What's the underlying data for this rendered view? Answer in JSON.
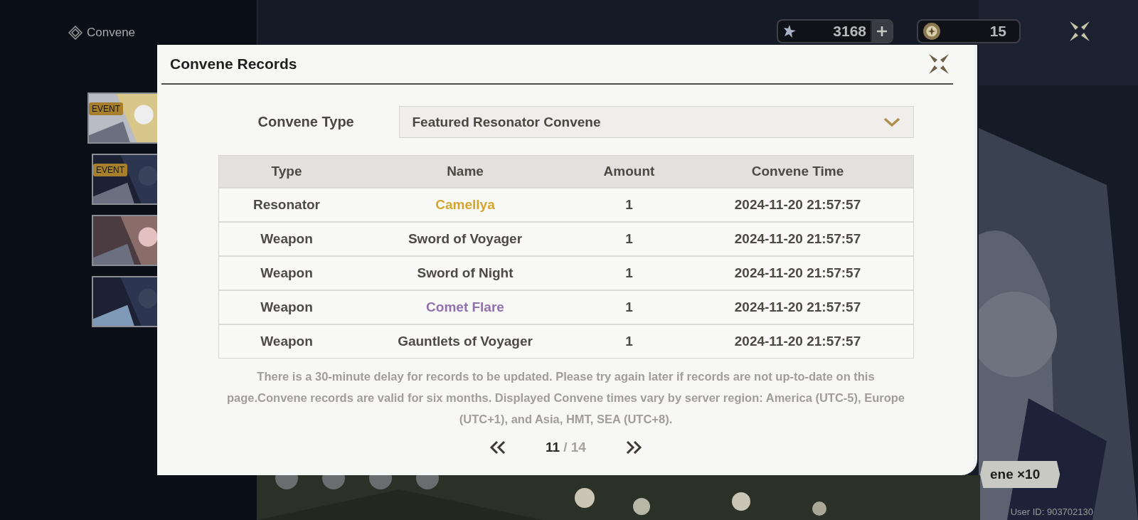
{
  "nav": {
    "title": "Convene"
  },
  "banner_badges": [
    "EVENT",
    "EVENT"
  ],
  "currencies": [
    {
      "kind": "astrite",
      "amount": "3168",
      "add": true
    },
    {
      "kind": "tide",
      "amount": "15",
      "add": false
    }
  ],
  "dialog": {
    "title": "Convene Records",
    "filter": {
      "label": "Convene Type",
      "value": "Featured Resonator Convene"
    },
    "table": {
      "columns": [
        "Type",
        "Name",
        "Amount",
        "Convene Time"
      ],
      "rows": [
        {
          "type": "Resonator",
          "name": "Camellya",
          "amount": "1",
          "time": "2024-11-20 21:57:57",
          "color": "#d4a52e"
        },
        {
          "type": "Weapon",
          "name": "Sword of Voyager",
          "amount": "1",
          "time": "2024-11-20 21:57:57",
          "color": "#4d4943"
        },
        {
          "type": "Weapon",
          "name": "Sword of Night",
          "amount": "1",
          "time": "2024-11-20 21:57:57",
          "color": "#4d4943"
        },
        {
          "type": "Weapon",
          "name": "Comet Flare",
          "amount": "1",
          "time": "2024-11-20 21:57:57",
          "color": "#9070ae"
        },
        {
          "type": "Weapon",
          "name": "Gauntlets of Voyager",
          "amount": "1",
          "time": "2024-11-20 21:57:57",
          "color": "#4d4943"
        }
      ]
    },
    "note": "There is a 30-minute delay for records to be updated. Please try again later if records are not up-to-date on this page.Convene records are valid for six months. Displayed Convene times vary by server region: America (UTC-5), Europe (UTC+1), and Asia, HMT, SEA (UTC+8).",
    "pagination": {
      "current": "11",
      "total": "/ 14"
    }
  },
  "footer": {
    "action": "ene ×10",
    "user_id": "User ID: 903702130"
  }
}
